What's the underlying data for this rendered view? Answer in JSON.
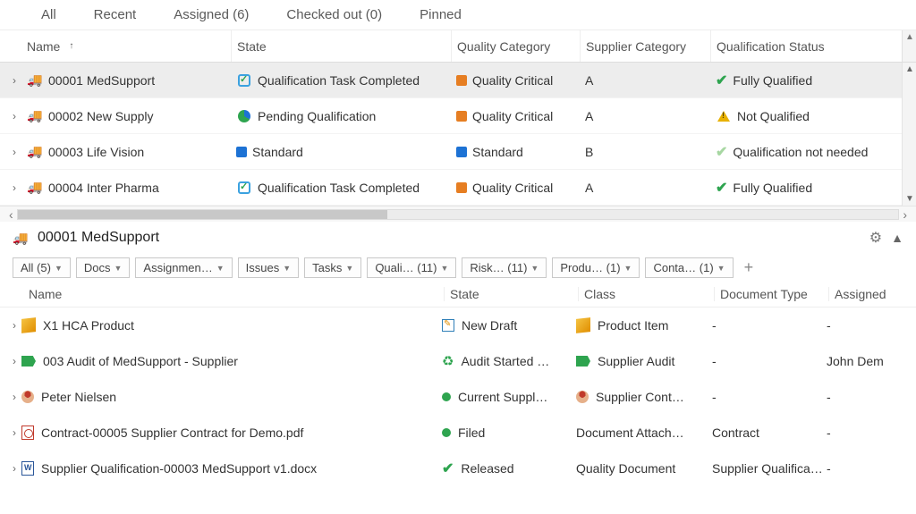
{
  "topTabs": {
    "all": "All",
    "recent": "Recent",
    "assigned": "Assigned (6)",
    "checkedOut": "Checked out (0)",
    "pinned": "Pinned"
  },
  "supplierGrid": {
    "headers": {
      "name": "Name",
      "state": "State",
      "qcat": "Quality Category",
      "scat": "Supplier Category",
      "qstat": "Qualification Status"
    },
    "rows": [
      {
        "selected": true,
        "name": "00001 MedSupport",
        "stateIcon": "clip",
        "state": "Qualification Task Completed",
        "qcatColor": "orange",
        "qcat": "Quality Critical",
        "scat": "A",
        "qstatIcon": "check-green",
        "qstat": "Fully Qualified"
      },
      {
        "selected": false,
        "name": "00002 New Supply",
        "stateIcon": "pie",
        "state": "Pending Qualification",
        "qcatColor": "orange",
        "qcat": "Quality Critical",
        "scat": "A",
        "qstatIcon": "warn",
        "qstat": "Not Qualified"
      },
      {
        "selected": false,
        "name": "00003 Life Vision",
        "stateIcon": "sq-blue",
        "state": "Standard",
        "qcatColor": "blue",
        "qcat": "Standard",
        "scat": "B",
        "qstatIcon": "check-lite",
        "qstat": "Qualification not needed"
      },
      {
        "selected": false,
        "name": "00004 Inter Pharma",
        "stateIcon": "clip",
        "state": "Qualification Task Completed",
        "qcatColor": "orange",
        "qcat": "Quality Critical",
        "scat": "A",
        "qstatIcon": "check-green",
        "qstat": "Fully Qualified"
      }
    ]
  },
  "detail": {
    "title": "00001 MedSupport",
    "subTabs": {
      "all": "All (5)",
      "docs": "Docs",
      "assign": "Assignmen…",
      "issues": "Issues",
      "tasks": "Tasks",
      "quali": "Quali…  (11)",
      "risk": "Risk…   (11)",
      "produ": "Produ…  (1)",
      "conta": "Conta…  (1)"
    },
    "headers": {
      "name": "Name",
      "state": "State",
      "class": "Class",
      "doct": "Document Type",
      "asg": "Assigned"
    },
    "rows": [
      {
        "icon": "box3d",
        "name": "X1 HCA Product",
        "stateIcon": "edit",
        "state": "New Draft",
        "classIcon": "box3d",
        "class": "Product Item",
        "doct": "-",
        "asg": "-"
      },
      {
        "icon": "tag",
        "name": "003 Audit of MedSupport - Supplier",
        "stateIcon": "recycle",
        "state": "Audit Started …",
        "classIcon": "tag",
        "class": "Supplier Audit",
        "doct": "-",
        "asg": "John Dem"
      },
      {
        "icon": "person",
        "name": "Peter Nielsen",
        "stateIcon": "dot-green",
        "state": "Current Suppl…",
        "classIcon": "person",
        "class": "Supplier Cont…",
        "doct": "-",
        "asg": "-"
      },
      {
        "icon": "pdf",
        "name": "Contract-00005 Supplier Contract for Demo.pdf",
        "stateIcon": "dot-green",
        "state": "Filed",
        "classIcon": "",
        "class": "Document Attach…",
        "doct": "Contract",
        "asg": "-"
      },
      {
        "icon": "docx",
        "name": "Supplier Qualification-00003 MedSupport v1.docx",
        "stateIcon": "check-green",
        "state": "Released",
        "classIcon": "",
        "class": "Quality Document",
        "doct": "Supplier Qualifica…",
        "asg": "-"
      }
    ]
  }
}
